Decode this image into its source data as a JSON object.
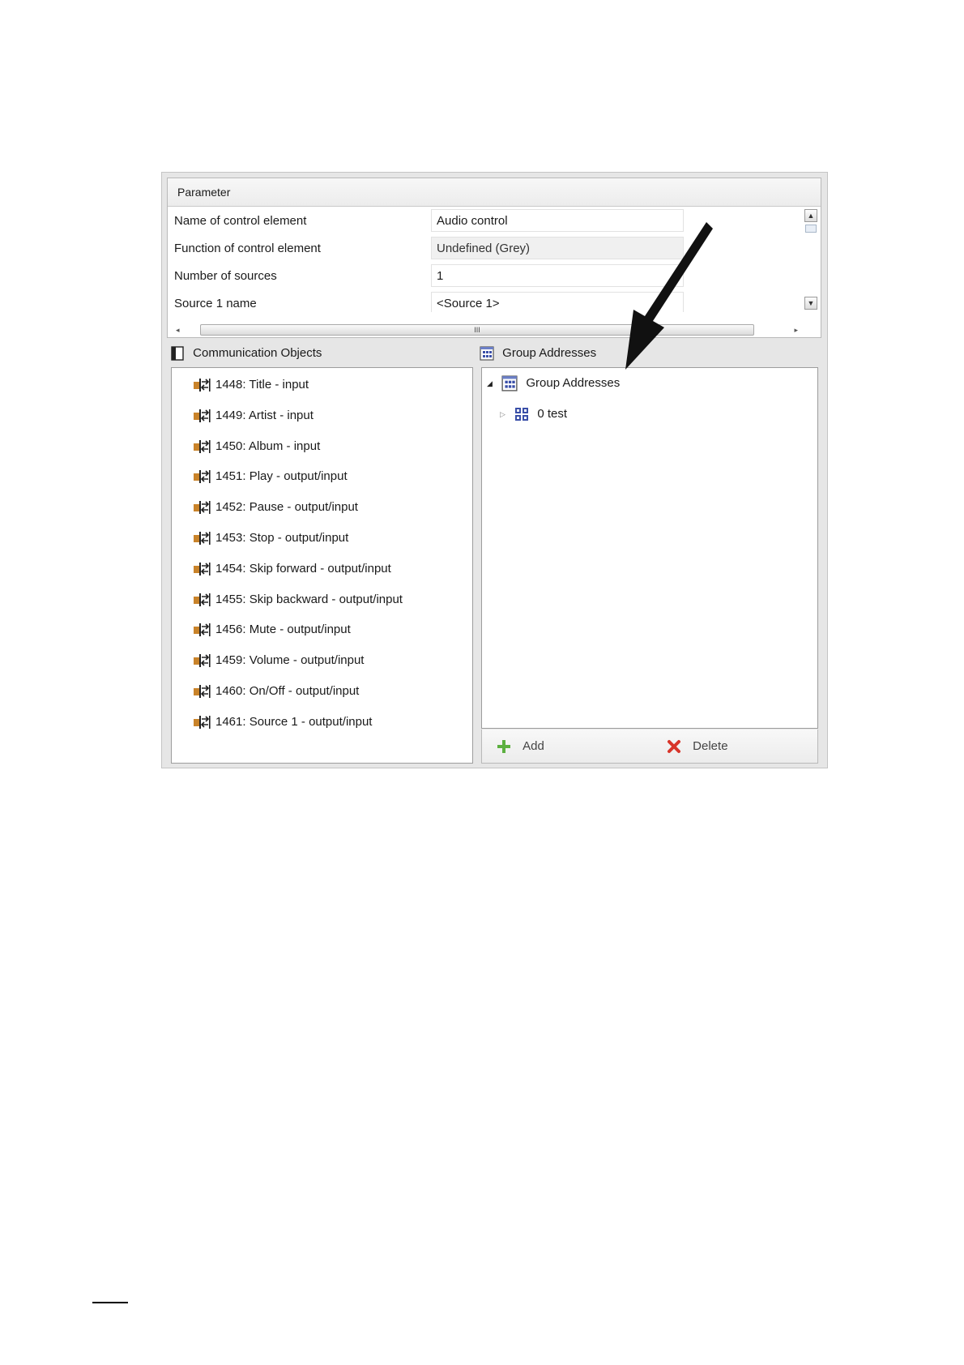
{
  "parameter_panel": {
    "header": "Parameter",
    "rows": [
      {
        "label": "Name of control element",
        "value": "Audio control"
      },
      {
        "label": "Function of control element",
        "value": "Undefined (Grey)"
      },
      {
        "label": "Number of sources",
        "value": "1"
      },
      {
        "label": "Source 1 name",
        "value": "<Source 1>"
      }
    ],
    "hscroll_grip": "III"
  },
  "communication_objects": {
    "title": "Communication Objects",
    "items": [
      "1448: Title - input",
      "1449: Artist - input",
      "1450: Album - input",
      "1451: Play - output/input",
      "1452: Pause - output/input",
      "1453: Stop - output/input",
      "1454: Skip forward - output/input",
      "1455: Skip backward - output/input",
      "1456: Mute - output/input",
      "1459: Volume - output/input",
      "1460: On/Off - output/input",
      "1461: Source 1 - output/input"
    ]
  },
  "group_addresses": {
    "title": "Group Addresses",
    "tree": {
      "root_label": "Group Addresses",
      "children": [
        {
          "label": "0 test"
        }
      ]
    },
    "toolbar": {
      "add_label": "Add",
      "delete_label": "Delete"
    }
  },
  "colors": {
    "add_green": "#5cb040",
    "delete_red": "#d8352a",
    "group_icon_blue": "#3a4fa8",
    "co_icon_orange": "#c9832a"
  }
}
